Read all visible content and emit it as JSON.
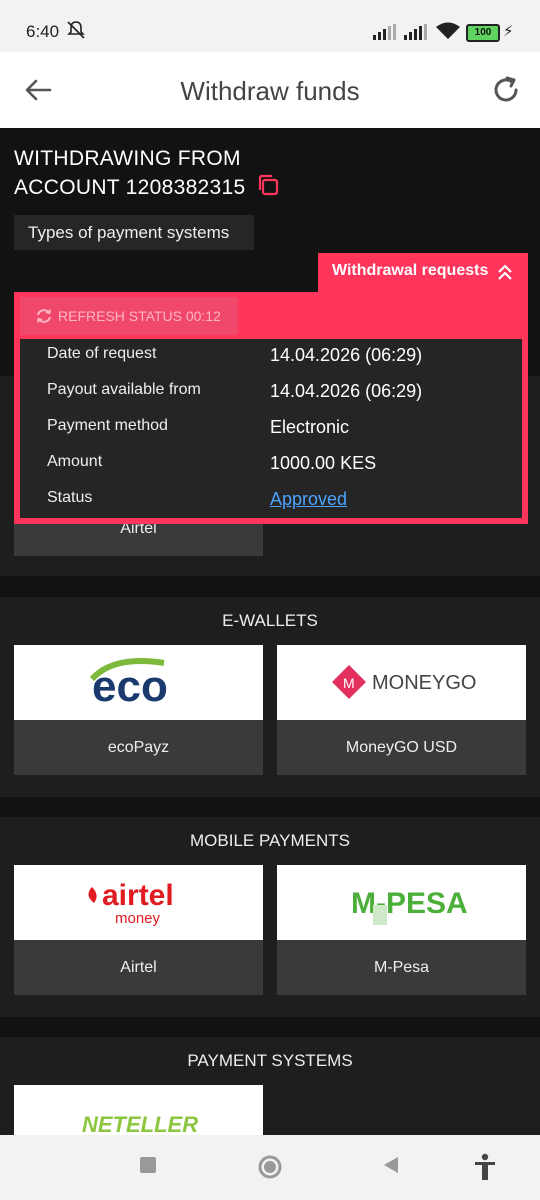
{
  "status_bar": {
    "time": "6:40",
    "battery": "100"
  },
  "app_bar": {
    "title": "Withdraw funds"
  },
  "account": {
    "line1": "WITHDRAWING FROM",
    "line2": "ACCOUNT 1208382315",
    "types_button": "Types of payment systems"
  },
  "withdrawal_requests": {
    "tab_label": "Withdrawal requests",
    "refresh_label": "REFRESH STATUS 00:12",
    "rows": [
      {
        "key": "Date of request",
        "value": "14.04.2026 (06:29)"
      },
      {
        "key": "Payout available from",
        "value": "14.04.2026 (06:29)"
      },
      {
        "key": "Payment method",
        "value": "Electronic"
      },
      {
        "key": "Amount",
        "value": "1000.00 KES"
      },
      {
        "key": "Status",
        "value": "Approved"
      }
    ]
  },
  "partial_card_label": "Airtel",
  "sections": [
    {
      "title": "E-WALLETS",
      "cards": [
        {
          "label": "ecoPayz",
          "logo": "eco"
        },
        {
          "label": "MoneyGO USD",
          "logo": "MONEYGO"
        }
      ]
    },
    {
      "title": "MOBILE PAYMENTS",
      "cards": [
        {
          "label": "Airtel",
          "logo_line1": "airtel",
          "logo_line2": "money"
        },
        {
          "label": "M-Pesa",
          "logo": "M-PESA"
        }
      ]
    },
    {
      "title": "PAYMENT SYSTEMS",
      "cards": [
        {
          "logo": "NETELLER"
        }
      ]
    }
  ],
  "colors": {
    "accent": "#ff355c",
    "link": "#4da3ff",
    "card_label_bg": "#3a3a3a"
  }
}
